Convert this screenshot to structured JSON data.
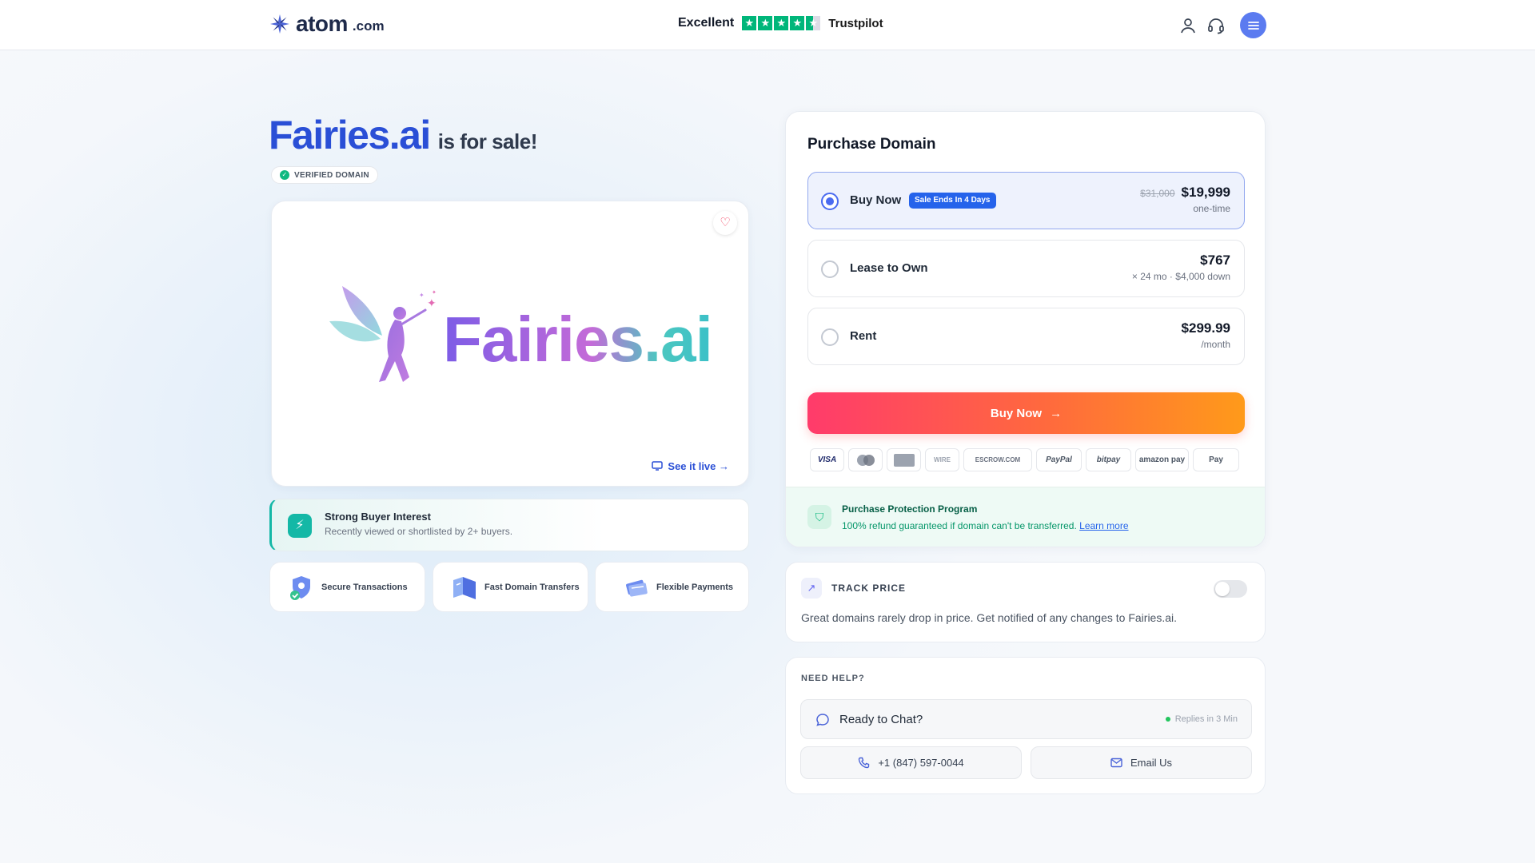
{
  "header": {
    "logo_text": "atom",
    "logo_suffix": ".com",
    "trust_rating_word": "Excellent",
    "trust_brand": "Trustpilot",
    "trust_stars": 4.5,
    "icons": [
      "user-icon",
      "headset-icon",
      "menu-icon"
    ]
  },
  "domain": {
    "name": "Fairies.ai",
    "for_sale_text": "is for sale!",
    "verified_label": "VERIFIED DOMAIN",
    "preview_logo_text": "Fairies.ai",
    "see_live_label": "See it live →"
  },
  "interest": {
    "title": "Strong Buyer Interest",
    "subtitle": "Recently viewed or shortlisted by 2+ buyers."
  },
  "features": [
    {
      "label": "Secure Transactions",
      "icon": "shield-icon"
    },
    {
      "label": "Fast Domain Transfers",
      "icon": "transfer-icon"
    },
    {
      "label": "Flexible Payments",
      "icon": "wallet-icon"
    }
  ],
  "purchase": {
    "title": "Purchase Domain",
    "options": [
      {
        "label": "Buy Now",
        "badge": "Sale Ends In 4 Days",
        "old_price": "$31,000",
        "price": "$19,999",
        "sub": "one-time",
        "selected": true
      },
      {
        "label": "Lease to Own",
        "price": "$767",
        "sub": "× 24 mo · $4,000 down",
        "selected": false
      },
      {
        "label": "Rent",
        "price": "$299.99",
        "sub": "/month",
        "selected": false
      }
    ],
    "buy_button_label": "Buy Now",
    "payment_methods": [
      "VISA",
      "MasterCard",
      "AMEX",
      "WIRE",
      "ESCROW.COM",
      "PayPal",
      "bitpay",
      "amazon pay",
      "Pay"
    ],
    "protection": {
      "title": "Purchase Protection Program",
      "text": "100% refund guaranteed if domain can't be transferred.",
      "link": "Learn more"
    }
  },
  "track": {
    "label": "TRACK PRICE",
    "description": "Great domains rarely drop in price. Get notified of any changes to Fairies.ai.",
    "enabled": false
  },
  "help": {
    "label": "NEED HELP?",
    "chat_text": "Ready to Chat?",
    "chat_status": "Replies in 3 Min",
    "phone": "+1 (847) 597-0044",
    "email_label": "Email Us"
  },
  "colors": {
    "brand_blue": "#2a4fd6",
    "accent_teal": "#14b8a6",
    "buy_gradient_start": "#ff3b6b",
    "buy_gradient_end": "#ff9a1a",
    "trustpilot_green": "#00b67a"
  }
}
